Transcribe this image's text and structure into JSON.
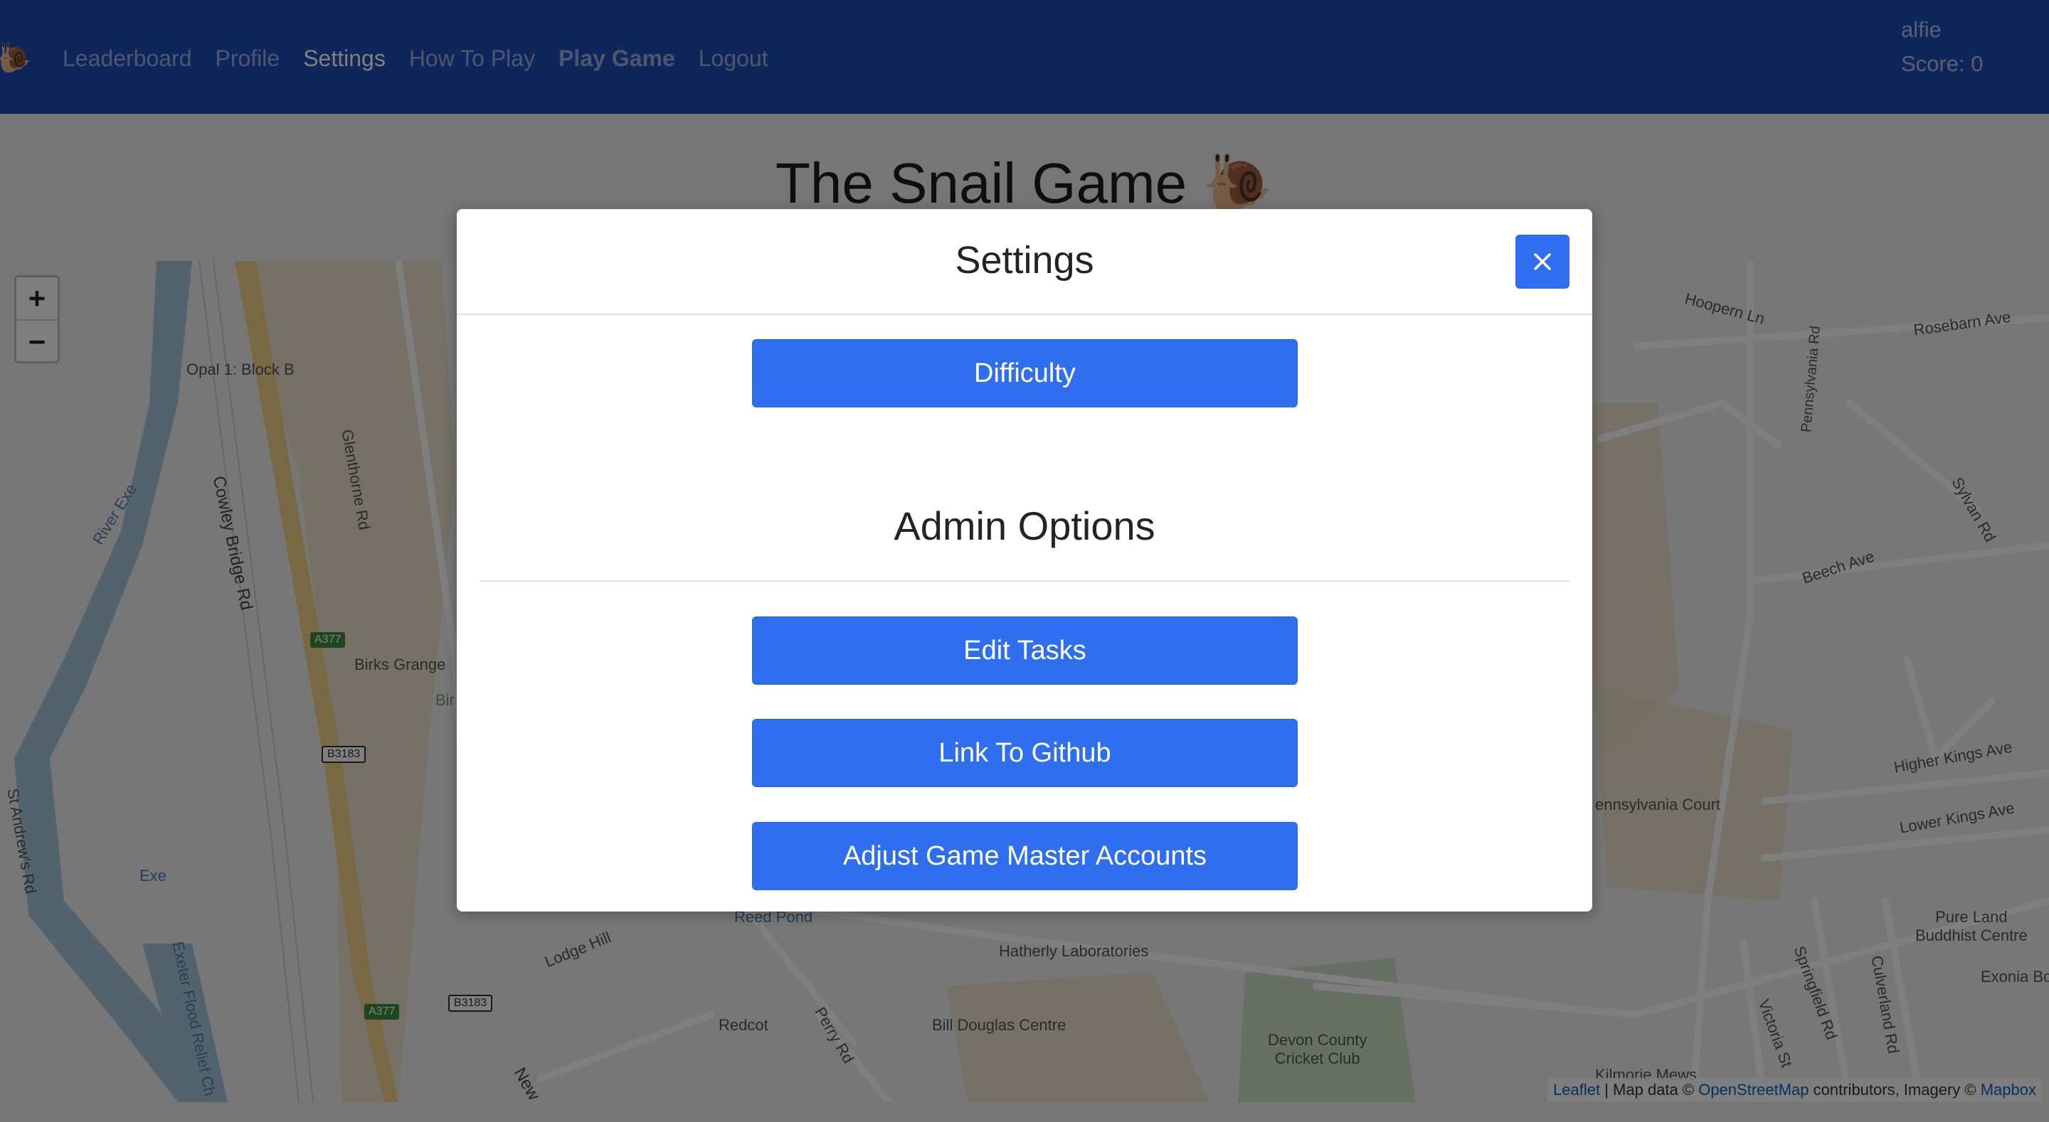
{
  "navbar": {
    "logo_icon": "snail-icon",
    "logo_glyph": "🐌",
    "links": [
      "Leaderboard",
      "Profile",
      "Settings",
      "How To Play",
      "Play Game",
      "Logout"
    ],
    "active_link": "Settings",
    "username": "alfie",
    "score": "Score: 0"
  },
  "page": {
    "title": "The Snail Game 🐌"
  },
  "map": {
    "zoom_in": "+",
    "zoom_out": "−",
    "labels": {
      "opal": "Opal 1: Block B",
      "cowley": "Cowley Bridge Rd",
      "glenthorne": "Glenthorne Rd",
      "river_exe": "River Exe",
      "birks": "Birks Grange",
      "bir": "Bir",
      "a377_1": "A377",
      "b3183_1": "B3183",
      "a377_2": "A377",
      "b3183_2": "B3183",
      "st_andrews": "St Andrew's Rd",
      "exe": "Exe",
      "exeter_flood": "Exeter Flood Relief Ch",
      "lodge_hill": "Lodge Hill",
      "reed_pond": "Reed Pond",
      "hatherly": "Hatherly Laboratories",
      "redcot": "Redcot",
      "perry": "Perry Rd",
      "bill_douglas": "Bill Douglas Centre",
      "new": "New",
      "devon_cricket_1": "Devon County",
      "devon_cricket_2": "Cricket Club",
      "kilmorie": "Kilmorie Mews",
      "hoopern": "Hoopern Ln",
      "pennsylvania_rd": "Pennsylvania Rd",
      "rosebarn": "Rosebarn Ave",
      "sylvan": "Sylvan Rd",
      "beech": "Beech Ave",
      "pennsylvania_court": "ennsylvania Court",
      "higher_kings": "Higher Kings Ave",
      "lower_kings": "Lower Kings Ave",
      "pure_land_1": "Pure Land",
      "pure_land_2": "Buddhist Centre",
      "exonia": "Exonia Bo",
      "springfield": "Springfield Rd",
      "victoria": "Victoria St",
      "culverland": "Culverland Rd"
    },
    "attribution": {
      "leaflet": "Leaflet",
      "sep": " | Map data © ",
      "osm": "OpenStreetMap",
      "mid": " contributors, Imagery © ",
      "mapbox": "Mapbox"
    }
  },
  "modal": {
    "title": "Settings",
    "close_icon": "close-icon",
    "difficulty_button": "Difficulty",
    "admin_title": "Admin Options",
    "edit_tasks_button": "Edit Tasks",
    "github_button": "Link To Github",
    "game_master_button": "Adjust Game Master Accounts"
  },
  "colors": {
    "navbar": "#1e4cb5",
    "primary_button": "#2f6fef",
    "backdrop": "rgba(0,0,0,0.5)"
  }
}
